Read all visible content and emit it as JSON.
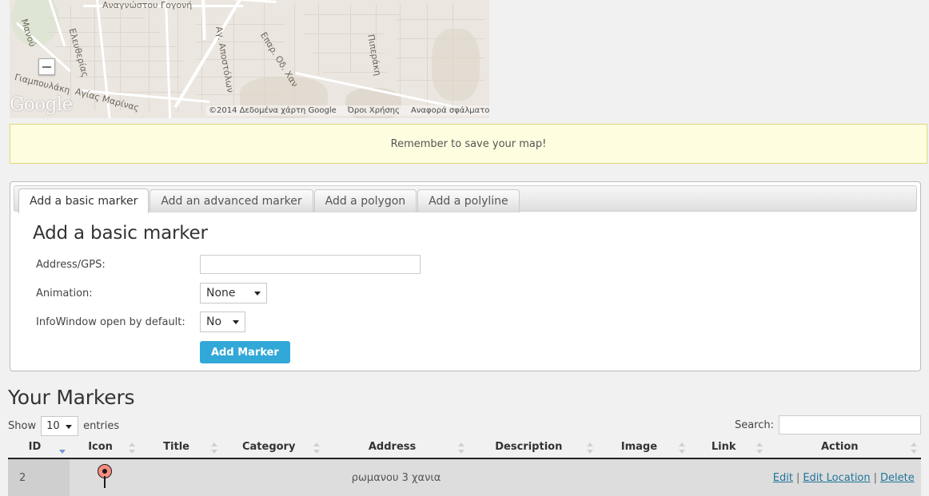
{
  "map": {
    "zoom_out_label": "−",
    "logo_text": "Google",
    "attribution": "©2014 Δεδομένα χάρτη Google",
    "terms": "Όροι Χρήσης",
    "report": "Αναφορά σφάλματος χάρτη",
    "street_labels": [
      "Αναγνώστου Γογονή",
      "Μανού",
      "Ελευθερίας",
      "Γιαμπουλάκη",
      "Αγίας Μαρίνας",
      "Αγ. Αποστόλων",
      "Επαρ. Οδ. Χαν",
      "Πιπεράκη"
    ]
  },
  "notice": {
    "text": "Remember to save your map!"
  },
  "tabs": [
    {
      "label": "Add a basic marker",
      "active": true
    },
    {
      "label": "Add an advanced marker",
      "active": false
    },
    {
      "label": "Add a polygon",
      "active": false
    },
    {
      "label": "Add a polyline",
      "active": false
    }
  ],
  "form": {
    "heading": "Add a basic marker",
    "address_label": "Address/GPS:",
    "address_value": "",
    "address_placeholder": "",
    "animation_label": "Animation:",
    "animation_value": "None",
    "animation_options": [
      "None"
    ],
    "infowindow_label": "InfoWindow open by default:",
    "infowindow_value": "No",
    "infowindow_options": [
      "No"
    ],
    "submit_label": "Add Marker"
  },
  "markers_section": {
    "title": "Your Markers",
    "show_label": "Show",
    "entries_label": "entries",
    "page_length": "10",
    "page_length_options": [
      "10"
    ],
    "search_label": "Search:",
    "search_value": "",
    "columns": [
      {
        "label": "ID",
        "sort": "desc"
      },
      {
        "label": "Icon",
        "sort": "none"
      },
      {
        "label": "Title",
        "sort": "none"
      },
      {
        "label": "Category",
        "sort": "none"
      },
      {
        "label": "Address",
        "sort": "none"
      },
      {
        "label": "Description",
        "sort": "none"
      },
      {
        "label": "Image",
        "sort": "none"
      },
      {
        "label": "Link",
        "sort": "none"
      },
      {
        "label": "Action",
        "sort": "none"
      }
    ],
    "rows": [
      {
        "id": "2",
        "icon": "map-pin-icon",
        "title": "",
        "category": "",
        "address": "ρωμανου 3 χανια",
        "description": "",
        "image": "",
        "link": "",
        "actions": {
          "edit": "Edit",
          "edit_location": "Edit Location",
          "delete": "Delete",
          "separator": "|"
        }
      }
    ]
  },
  "colors": {
    "accent_button": "#32a8d8",
    "notice_bg": "#fffddf",
    "notice_border": "#e0d97b",
    "link": "#21759b",
    "pin": "#f98d82"
  }
}
